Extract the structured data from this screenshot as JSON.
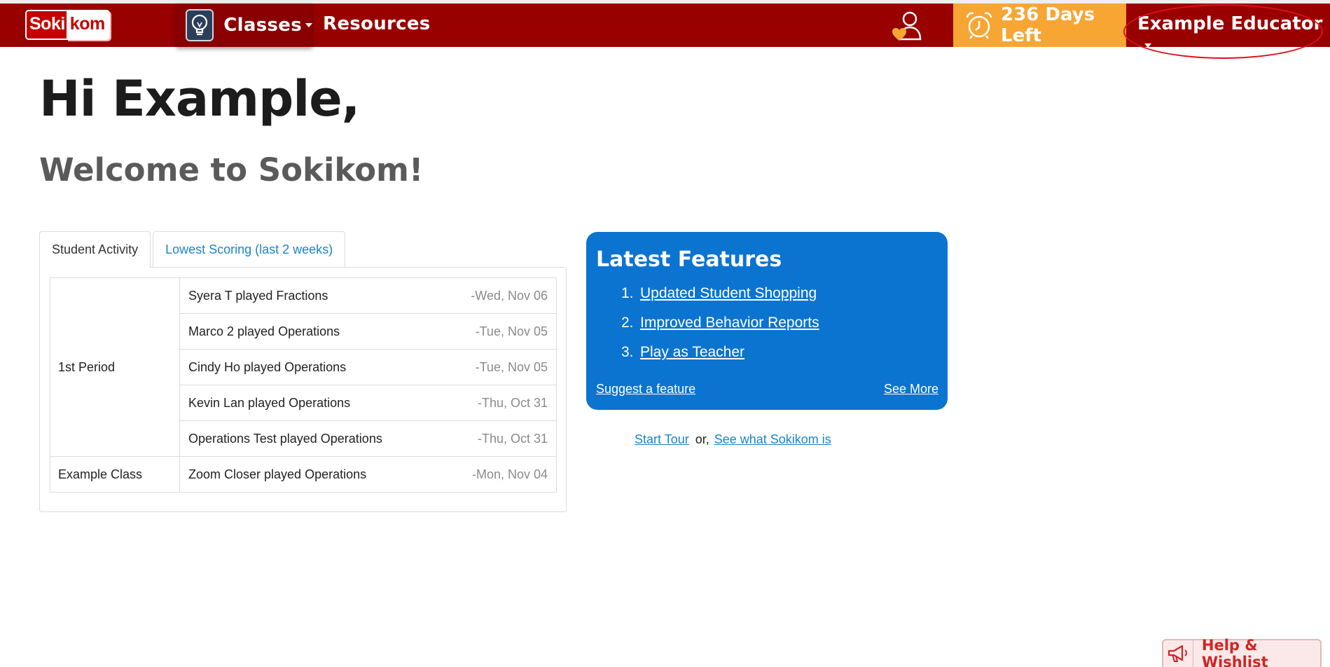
{
  "navbar": {
    "logo": {
      "part1": "Soki",
      "part2": "kom"
    },
    "classes_label": "Classes",
    "resources_label": "Resources",
    "days_left": "236 Days Left",
    "educator_name": "Example Educator",
    "icons": {
      "bulb": "lightbulb-icon",
      "user": "user-heart-icon",
      "alarm": "alarm-clock-icon"
    },
    "colors": {
      "bar": "#990000",
      "days": "#f7a634",
      "highlight": "#e0101a"
    }
  },
  "greeting": {
    "hi": "Hi Example,",
    "welcome": "Welcome to Sokikom!"
  },
  "tabs": {
    "student_activity": "Student Activity",
    "lowest_scoring": "Lowest Scoring (last 2 weeks)"
  },
  "activity": {
    "groups": [
      {
        "class": "1st Period",
        "rows": [
          {
            "text": "Syera T played Fractions",
            "date": "-Wed, Nov 06"
          },
          {
            "text": "Marco 2 played Operations",
            "date": "-Tue, Nov 05"
          },
          {
            "text": "Cindy Ho played Operations",
            "date": "-Tue, Nov 05"
          },
          {
            "text": "Kevin Lan played Operations",
            "date": "-Thu, Oct 31"
          },
          {
            "text": "Operations Test played Operations",
            "date": "-Thu, Oct 31"
          }
        ]
      },
      {
        "class": "Example Class",
        "rows": [
          {
            "text": "Zoom Closer played Operations",
            "date": "-Mon, Nov 04"
          }
        ]
      }
    ]
  },
  "features": {
    "title": "Latest Features",
    "items": [
      {
        "num": "1.",
        "label": "Updated Student Shopping"
      },
      {
        "num": "2.",
        "label": "Improved Behavior Reports"
      },
      {
        "num": "3.",
        "label": "Play as Teacher"
      }
    ],
    "suggest": "Suggest a feature",
    "see_more": "See More",
    "color": "#0b74d1"
  },
  "tour": {
    "start_tour": "Start Tour",
    "or": "or,",
    "see_what": "See what Sokikom is"
  },
  "help": {
    "label": "Help & Wishlist",
    "icon": "megaphone-icon"
  }
}
